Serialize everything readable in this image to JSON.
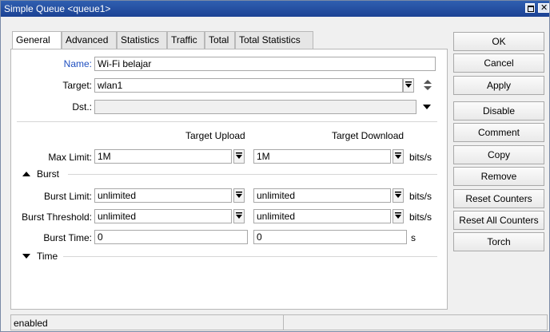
{
  "window": {
    "title": "Simple Queue <queue1>"
  },
  "tabs": [
    "General",
    "Advanced",
    "Statistics",
    "Traffic",
    "Total",
    "Total Statistics"
  ],
  "form": {
    "name_label": "Name:",
    "name_value": "Wi-Fi belajar",
    "target_label": "Target:",
    "target_value": "wlan1",
    "dst_label": "Dst.:",
    "dst_value": "",
    "col_upload": "Target Upload",
    "col_download": "Target Download",
    "max_limit_label": "Max Limit:",
    "max_limit_upload": "1M",
    "max_limit_download": "1M",
    "unit": "bits/s",
    "burst_section": "Burst",
    "burst_limit_label": "Burst Limit:",
    "burst_limit_upload": "unlimited",
    "burst_limit_download": "unlimited",
    "burst_threshold_label": "Burst Threshold:",
    "burst_threshold_upload": "unlimited",
    "burst_threshold_download": "unlimited",
    "burst_time_label": "Burst Time:",
    "burst_time_upload": "0",
    "burst_time_download": "0",
    "burst_time_unit": "s",
    "time_section": "Time"
  },
  "buttons": {
    "ok": "OK",
    "cancel": "Cancel",
    "apply": "Apply",
    "disable": "Disable",
    "comment": "Comment",
    "copy": "Copy",
    "remove": "Remove",
    "reset_counters": "Reset Counters",
    "reset_all_counters": "Reset All Counters",
    "torch": "Torch"
  },
  "status": {
    "text": "enabled"
  },
  "colors": {
    "titlebar": "#1c4294",
    "label_highlight": "#1f4fc0"
  }
}
